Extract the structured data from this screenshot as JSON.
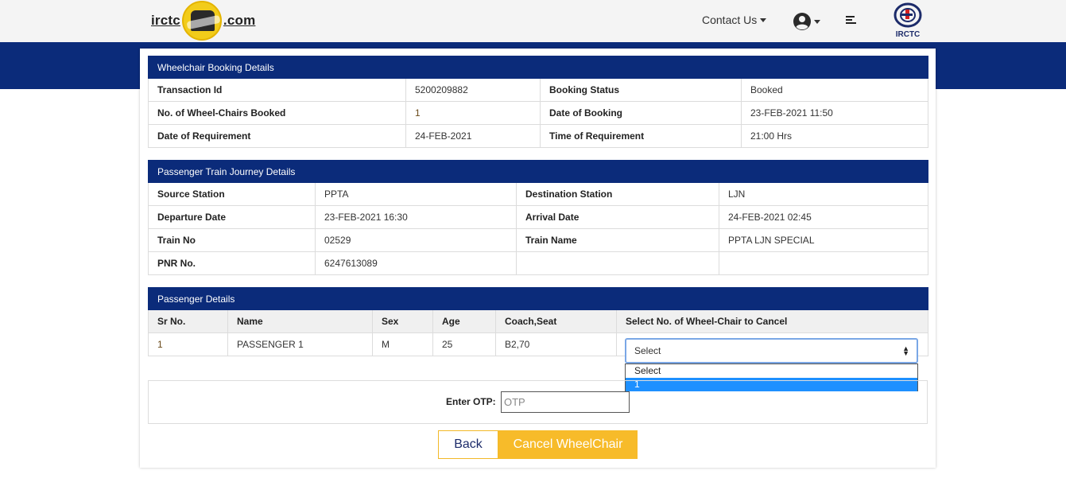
{
  "header": {
    "logo_left": "irctc",
    "logo_right": ".com",
    "contact_label": "Contact Us",
    "brand_caption": "IRCTC"
  },
  "booking": {
    "title": "Wheelchair Booking Details",
    "rows": [
      {
        "l1": "Transaction Id",
        "v1": "5200209882",
        "l2": "Booking Status",
        "v2": "Booked"
      },
      {
        "l1": "No. of Wheel-Chairs Booked",
        "v1": "1",
        "l2": "Date of Booking",
        "v2": "23-FEB-2021 11:50"
      },
      {
        "l1": "Date of Requirement",
        "v1": "24-FEB-2021",
        "l2": "Time of Requirement",
        "v2": "21:00 Hrs"
      }
    ]
  },
  "journey": {
    "title": "Passenger Train Journey Details",
    "rows": [
      {
        "l1": "Source Station",
        "v1": "PPTA",
        "l2": "Destination Station",
        "v2": "LJN"
      },
      {
        "l1": "Departure Date",
        "v1": "23-FEB-2021 16:30",
        "l2": "Arrival Date",
        "v2": "24-FEB-2021 02:45"
      },
      {
        "l1": "Train No",
        "v1": "02529",
        "l2": "Train Name",
        "v2": "PPTA LJN SPECIAL"
      },
      {
        "l1": "PNR No.",
        "v1": "6247613089",
        "l2": "",
        "v2": ""
      }
    ]
  },
  "passengers": {
    "title": "Passenger Details",
    "columns": [
      "Sr No.",
      "Name",
      "Sex",
      "Age",
      "Coach,Seat",
      "Select No. of Wheel-Chair to Cancel"
    ],
    "rows": [
      {
        "sr": "1",
        "name": "PASSENGER 1",
        "sex": "M",
        "age": "25",
        "seat": "B2,70"
      }
    ],
    "select_value": "Select",
    "options": [
      "Select",
      "1"
    ]
  },
  "otp": {
    "label": "Enter OTP:",
    "placeholder": "OTP",
    "value": ""
  },
  "actions": {
    "back_label": "Back",
    "cancel_label": "Cancel WheelChair"
  },
  "colors": {
    "primary_navy": "#0b2b7a",
    "accent_yellow": "#f7bb2a",
    "highlight_blue": "#1e90ff"
  }
}
